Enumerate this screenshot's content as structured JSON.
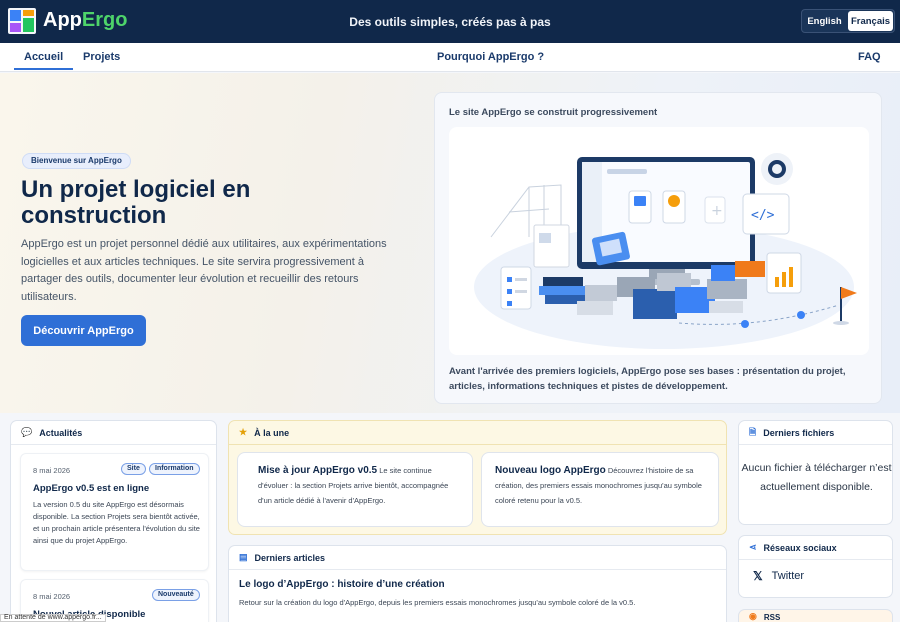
{
  "header": {
    "brand_app": "App",
    "brand_ergo": "Ergo",
    "tagline": "Des outils simples, créés pas à pas",
    "lang_en": "English",
    "lang_fr": "Français"
  },
  "nav": {
    "home": "Accueil",
    "projects": "Projets",
    "why": "Pourquoi AppErgo ?",
    "faq": "FAQ"
  },
  "hero": {
    "pill": "Bienvenue sur AppErgo",
    "title": "Un projet logiciel en construction",
    "lead": "AppErgo est un projet personnel dédié aux utilitaires, aux expérimentations logicielles et aux articles techniques. Le site servira progressivement à partager des outils, documenter leur évolution et recueillir des retours utilisateurs.",
    "cta": "Découvrir AppErgo",
    "card_caption": "Le site AppErgo se construit progressivement",
    "card_desc": "Avant l'arrivée des premiers logiciels, AppErgo pose ses bases : présentation du projet, articles, informations techniques et pistes de développement."
  },
  "news": {
    "title": "Actualités",
    "items": [
      {
        "date": "8 mai 2026",
        "badges": [
          "Site",
          "Information"
        ],
        "title": "AppErgo v0.5 est en ligne",
        "text": "La version 0.5 du site AppErgo est désormais disponible. La section Projets sera bientôt activée, et un prochain article présentera l'évolution du site ainsi que du projet AppErgo."
      },
      {
        "date": "8 mai 2026",
        "badges": [
          "Nouveauté"
        ],
        "title": "Nouvel article disponible",
        "text": ""
      }
    ]
  },
  "featured": {
    "title": "À la une",
    "items": [
      {
        "title": "Mise à jour AppErgo v0.5",
        "text": "Le site continue d'évoluer : la section Projets arrive bientôt, accompagnée d'un article dédié à l'avenir d'AppErgo."
      },
      {
        "title": "Nouveau logo AppErgo",
        "text": "Découvrez l'histoire de sa création, des premiers essais monochromes jusqu'au symbole coloré retenu pour la v0.5."
      }
    ]
  },
  "articles": {
    "title": "Derniers articles",
    "items": [
      {
        "title": "Le logo d’AppErgo : histoire d’une création",
        "text": "Retour sur la création du logo d'AppErgo, depuis les premiers essais monochromes jusqu'au symbole coloré de la v0.5."
      }
    ]
  },
  "files": {
    "title": "Derniers fichiers",
    "empty": "Aucun fichier à télécharger n’est actuellement disponible."
  },
  "social": {
    "title": "Réseaux sociaux",
    "twitter": "Twitter"
  },
  "rss": {
    "title": "RSS"
  },
  "status": {
    "text": "En attente de www.appergo.fr..."
  },
  "colors": {
    "header_bg": "#10284a",
    "accent": "#2f6fd6",
    "brand_green": "#4ed46a",
    "featured_bg": "#fdf8e4"
  }
}
